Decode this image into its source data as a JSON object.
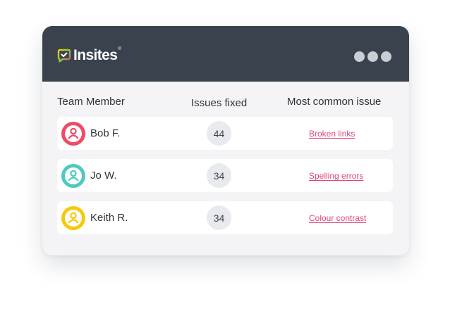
{
  "brand": {
    "name": "Insites",
    "registered_mark": "®"
  },
  "window": {
    "controls": [
      "window-dot",
      "window-dot",
      "window-dot"
    ]
  },
  "table": {
    "columns": {
      "member": "Team Member",
      "fixed": "Issues fixed",
      "issue": "Most common issue"
    },
    "rows": [
      {
        "name": "Bob F.",
        "fixed": "44",
        "issue": "Broken links",
        "avatar_color": "#ee4b67"
      },
      {
        "name": "Jo W.",
        "fixed": "34",
        "issue": "Spelling errors",
        "avatar_color": "#4ec9bf"
      },
      {
        "name": "Keith R.",
        "fixed": "34",
        "issue": "Colour contrast",
        "avatar_color": "#f6c90e"
      }
    ]
  },
  "colors": {
    "header_bg": "#3a434d",
    "card_bg": "#f4f4f6",
    "link": "#e0467c",
    "count_bg": "#e9eaee",
    "window_dot": "#c9ced4"
  }
}
